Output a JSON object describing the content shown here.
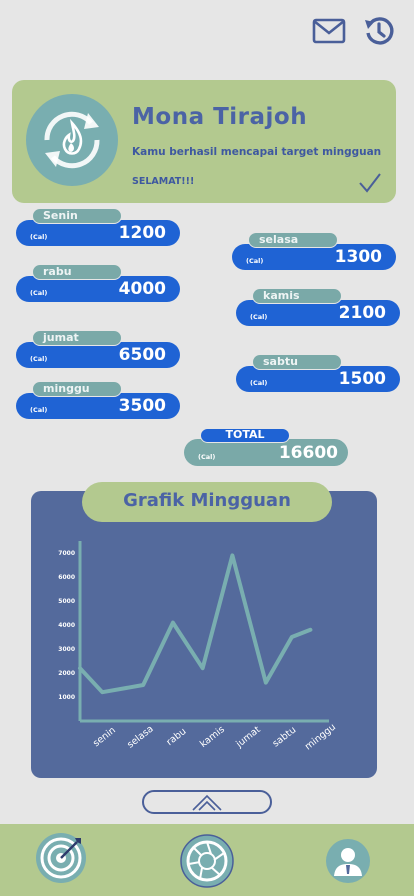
{
  "header": {
    "mail_icon": "mail-icon",
    "history_icon": "history-icon"
  },
  "profile": {
    "name": "Mona Tirajoh",
    "message": "Kamu berhasil mencapai target mingguan",
    "congrats": "SELAMAT!!!",
    "avatar_icon": "flame-recycle-icon"
  },
  "days": [
    {
      "label": "Senin",
      "unit": "(Cal)",
      "value": "1200"
    },
    {
      "label": "selasa",
      "unit": "(Cal)",
      "value": "1300"
    },
    {
      "label": "rabu",
      "unit": "(Cal)",
      "value": "4000"
    },
    {
      "label": "kamis",
      "unit": "(Cal)",
      "value": "2100"
    },
    {
      "label": "jumat",
      "unit": "(Cal)",
      "value": "6500"
    },
    {
      "label": "sabtu",
      "unit": "(Cal)",
      "value": "1500"
    },
    {
      "label": "minggu",
      "unit": "(Cal)",
      "value": "3500"
    }
  ],
  "total": {
    "label": "TOTAL",
    "unit": "(Cal)",
    "value": "16600"
  },
  "chart_title": "Grafik Mingguan",
  "chart_data": {
    "type": "line",
    "title": "Grafik Mingguan",
    "categories": [
      "senin",
      "selasa",
      "rabu",
      "kamis",
      "jumat",
      "sabtu",
      "minggu"
    ],
    "x": [
      0,
      1,
      2,
      3,
      4,
      5,
      6,
      7,
      8,
      9,
      10
    ],
    "values": [
      2200,
      1200,
      1500,
      4100,
      2200,
      6900,
      1600,
      3500,
      3800
    ],
    "x_positions": [
      0,
      0.6,
      1.7,
      2.5,
      3.3,
      4.1,
      5.0,
      5.7,
      6.2
    ],
    "yticks": [
      1000,
      2000,
      3000,
      4000,
      5000,
      6000,
      7000
    ],
    "ylim": [
      0,
      7500
    ],
    "color": "#79aeb0"
  },
  "nav": {
    "target_icon": "target-icon",
    "camera_icon": "camera-aperture-icon",
    "profile_icon": "user-icon"
  },
  "colors": {
    "bg": "#e6e6e6",
    "green": "#b3c98f",
    "blue": "#1f63d4",
    "teal": "#7aa9a8",
    "navy": "#546a9c"
  }
}
